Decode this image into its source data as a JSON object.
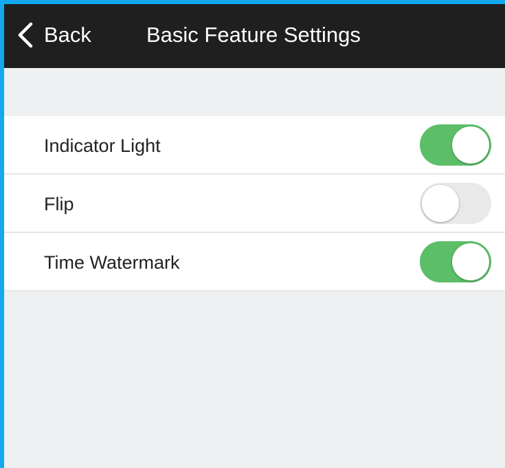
{
  "navbar": {
    "back_label": "Back",
    "title": "Basic Feature Settings"
  },
  "settings": [
    {
      "label": "Indicator Light",
      "enabled": true
    },
    {
      "label": "Flip",
      "enabled": false
    },
    {
      "label": "Time Watermark",
      "enabled": true
    }
  ],
  "colors": {
    "accent_frame": "#12a9ee",
    "navbar_bg": "#1f1f1f",
    "toggle_on": "#5cbf68",
    "toggle_off": "#e9e9ea",
    "page_bg": "#eff0f2"
  },
  "icons": {
    "back": "chevron-left-icon"
  }
}
